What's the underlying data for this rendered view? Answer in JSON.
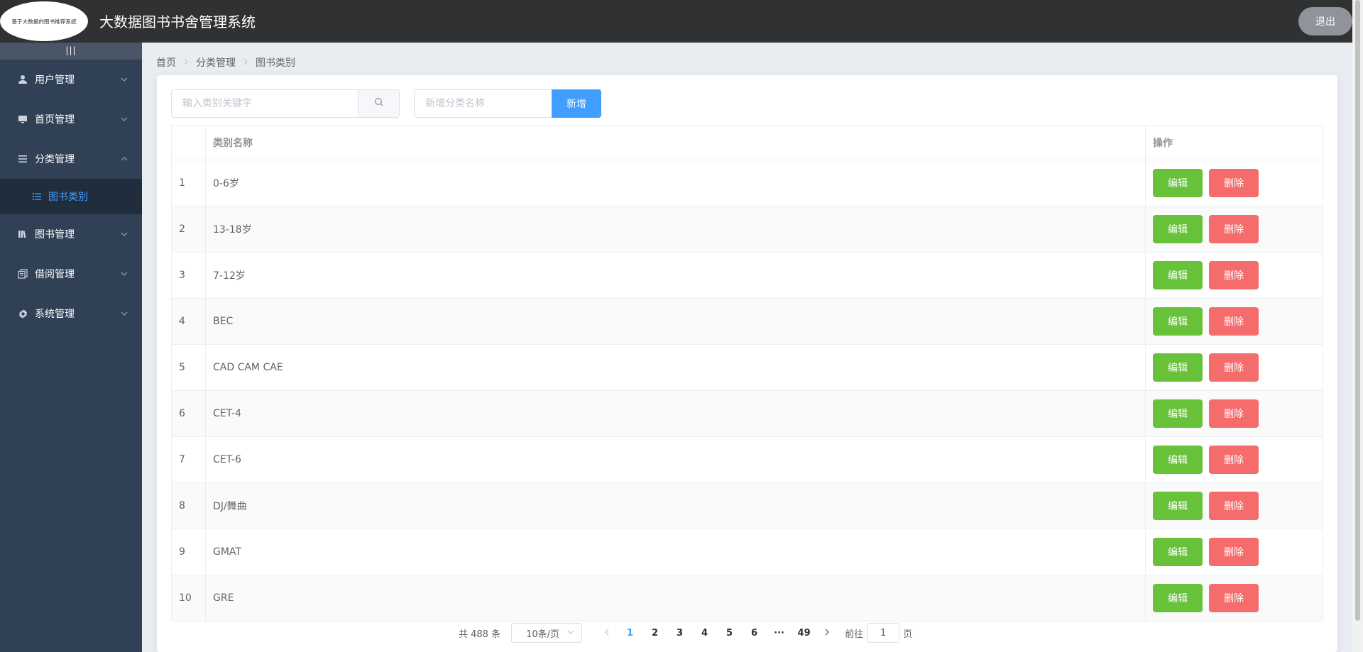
{
  "header": {
    "logo_text": "基于大数据的图书推荐系统",
    "title": "大数据图书书舍管理系统",
    "logout_label": "退出"
  },
  "sidebar": {
    "collapse_label": "|||",
    "items": [
      {
        "label": "用户管理",
        "icon": "user-icon",
        "expanded": false
      },
      {
        "label": "首页管理",
        "icon": "monitor-icon",
        "expanded": false
      },
      {
        "label": "分类管理",
        "icon": "menu-icon",
        "expanded": true,
        "children": [
          {
            "label": "图书类别",
            "icon": "list-icon",
            "active": true
          }
        ]
      },
      {
        "label": "图书管理",
        "icon": "books-icon",
        "expanded": false
      },
      {
        "label": "借阅管理",
        "icon": "document-copy-icon",
        "expanded": false
      },
      {
        "label": "系统管理",
        "icon": "gear-icon",
        "expanded": false
      }
    ]
  },
  "breadcrumb": [
    "首页",
    "分类管理",
    "图书类别"
  ],
  "toolbar": {
    "search_placeholder": "输入类别关键字",
    "search_value": "",
    "add_placeholder": "新增分类名称",
    "add_value": "",
    "add_label": "新增"
  },
  "table": {
    "headers": {
      "index": "",
      "name": "类别名称",
      "ops": "操作"
    },
    "edit_label": "编辑",
    "delete_label": "删除",
    "rows": [
      {
        "index": "1",
        "name": "0-6岁"
      },
      {
        "index": "2",
        "name": "13-18岁"
      },
      {
        "index": "3",
        "name": "7-12岁"
      },
      {
        "index": "4",
        "name": "BEC"
      },
      {
        "index": "5",
        "name": "CAD CAM CAE"
      },
      {
        "index": "6",
        "name": "CET-4"
      },
      {
        "index": "7",
        "name": "CET-6"
      },
      {
        "index": "8",
        "name": "DJ/舞曲"
      },
      {
        "index": "9",
        "name": "GMAT"
      },
      {
        "index": "10",
        "name": "GRE"
      }
    ]
  },
  "pagination": {
    "total_label": "共 488 条",
    "page_size": "10条/页",
    "pages": [
      "1",
      "2",
      "3",
      "4",
      "5",
      "6",
      "···",
      "49"
    ],
    "current": "1",
    "goto_prefix": "前往",
    "goto_value": "1",
    "goto_suffix": "页"
  },
  "colors": {
    "header_bg": "#303133",
    "sidebar_bg": "#304156",
    "submenu_bg": "#1f2d3d",
    "primary": "#409eff",
    "success": "#67c23a",
    "danger": "#f56c6c"
  }
}
